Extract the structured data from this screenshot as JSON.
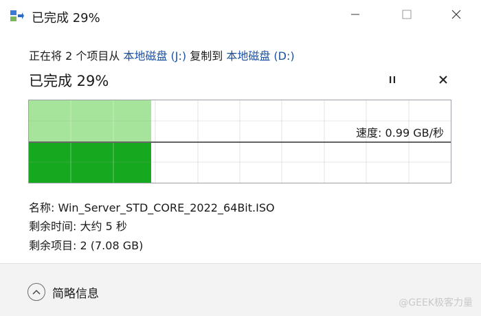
{
  "window": {
    "title": "已完成 29%",
    "buttons": {
      "minimize": "minimize",
      "maximize": "maximize",
      "close": "close"
    }
  },
  "copy": {
    "prefix": "正在将 2 个项目从 ",
    "source": "本地磁盘 (J:)",
    "middle": " 复制到 ",
    "destination": "本地磁盘 (D:)"
  },
  "progress": {
    "status_text": "已完成 29%",
    "percent": 29,
    "speed_text": "速度: 0.99 GB/秒"
  },
  "details": {
    "name_label": "名称: ",
    "name_value": "Win_Server_STD_CORE_2022_64Bit.ISO",
    "time_label": "剩余时间: ",
    "time_value": "大约 5 秒",
    "items_label": "剩余项目: ",
    "items_value": "2 (7.08 GB)"
  },
  "footer": {
    "less_details_label": "简略信息"
  },
  "watermark": "@GEEK极客力量",
  "colors": {
    "progress_light": "#a6e39b",
    "progress_dark": "#16a81f",
    "link": "#1a4fa0",
    "grid": "#dfe6dd"
  },
  "icons": [
    "copy-app-icon",
    "minimize-icon",
    "maximize-icon",
    "close-icon",
    "pause-icon",
    "cancel-icon",
    "chevron-up-icon"
  ]
}
